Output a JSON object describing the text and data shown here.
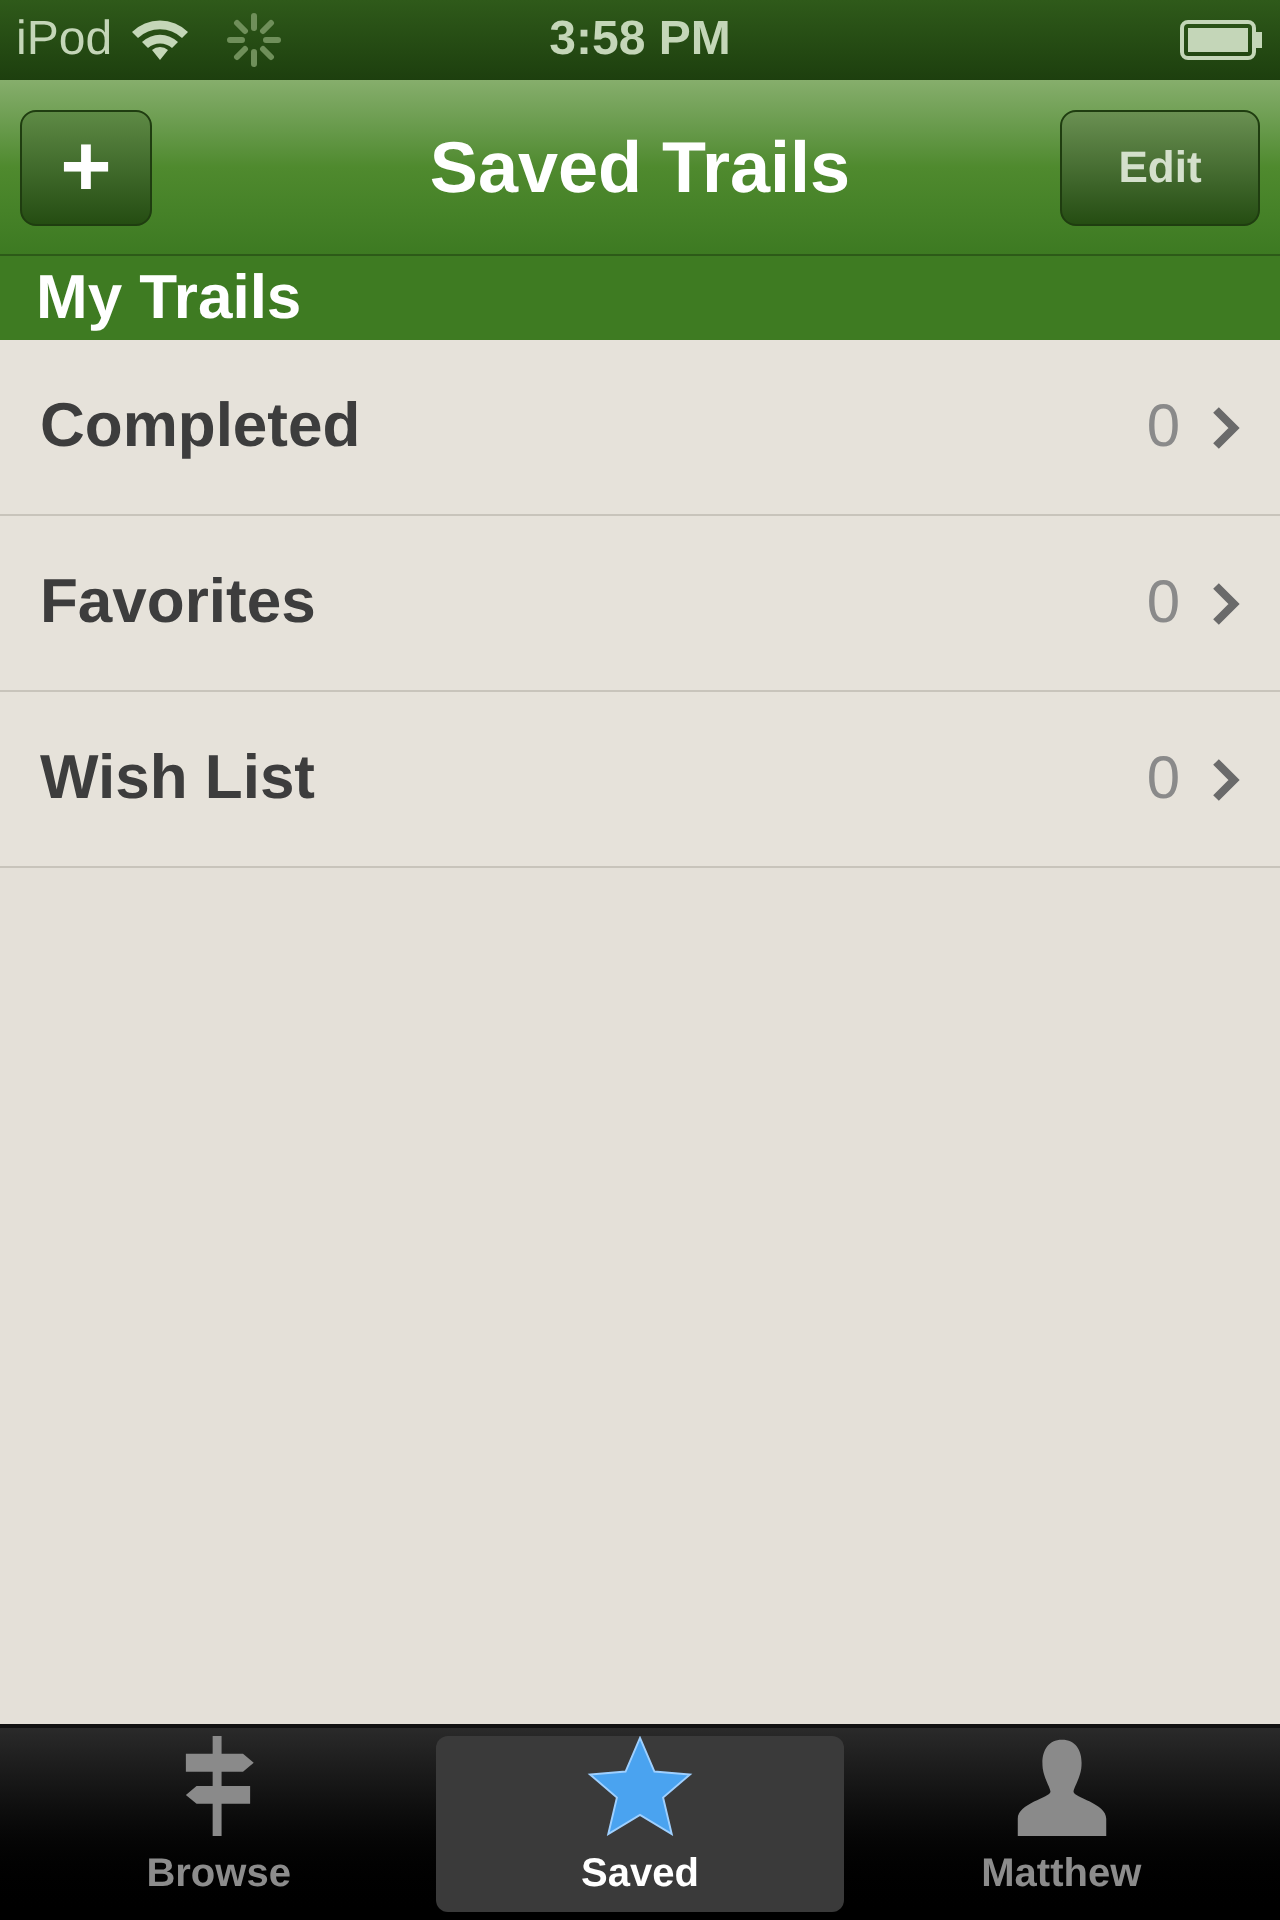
{
  "status_bar": {
    "carrier": "iPod",
    "time": "3:58 PM"
  },
  "nav_bar": {
    "left_button": "+",
    "title": "Saved Trails",
    "right_button": "Edit"
  },
  "section": {
    "title": "My Trails"
  },
  "rows": [
    {
      "label": "Completed",
      "count": "0"
    },
    {
      "label": "Favorites",
      "count": "0"
    },
    {
      "label": "Wish List",
      "count": "0"
    }
  ],
  "tab_bar": [
    {
      "kind": "signpost",
      "label": "Browse",
      "selected": false
    },
    {
      "kind": "star",
      "label": "Saved",
      "selected": true
    },
    {
      "kind": "person",
      "label": "Matthew",
      "selected": false
    }
  ]
}
